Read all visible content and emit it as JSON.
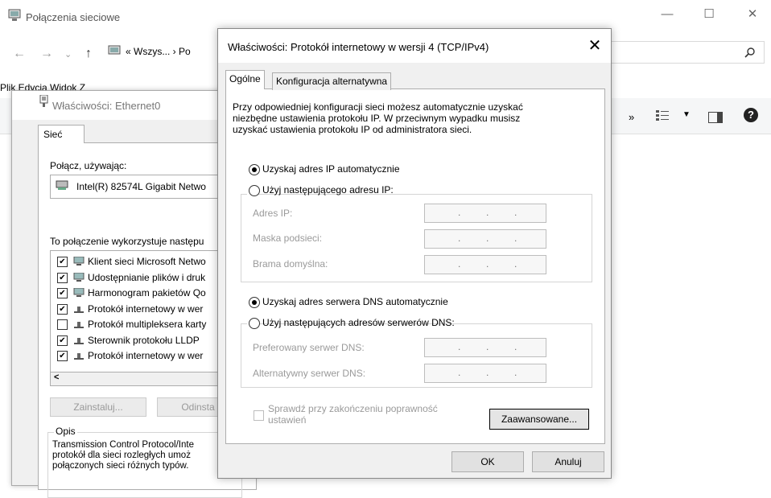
{
  "bg": {
    "title": "Połączenia sieciowe",
    "address": "« Wszys... › Po",
    "menu": "Plik   Edycja   Widok   Z",
    "toolbar_chevron": "»",
    "controls": {
      "minimize": "—",
      "maximize": "☐",
      "close": "✕"
    }
  },
  "eth": {
    "title": "Właściwości: Ethernet0",
    "tab": "Sieć",
    "connect_using_label": "Połącz, używając:",
    "adapter": "Intel(R) 82574L Gigabit Netwo",
    "uses_label": "To połączenie wykorzystuje następu",
    "items": [
      {
        "checked": true,
        "label": "Klient sieci Microsoft Netwo"
      },
      {
        "checked": true,
        "label": "Udostępnianie plików i druk"
      },
      {
        "checked": true,
        "label": "Harmonogram pakietów Qo"
      },
      {
        "checked": true,
        "label": "Protokół internetowy w wer"
      },
      {
        "checked": false,
        "label": "Protokół multipleksera karty"
      },
      {
        "checked": true,
        "label": "Sterownik protokołu LLDP"
      },
      {
        "checked": true,
        "label": "Protokół internetowy w wer"
      }
    ],
    "scroll_left": "<",
    "install_btn": "Zainstaluj...",
    "uninstall_btn": "Odinsta",
    "desc_legend": "Opis",
    "desc_lines": [
      "Transmission Control Protocol/Inte",
      "protokół dla sieci rozległych umoż",
      "połączonych sieci różnych typów."
    ]
  },
  "ipv4": {
    "title": "Właściwości: Protokół internetowy w wersji 4 (TCP/IPv4)",
    "close": "✕",
    "tabs": [
      "Ogólne",
      "Konfiguracja alternatywna"
    ],
    "intro_lines": [
      "Przy odpowiedniej konfiguracji sieci możesz automatycznie uzyskać",
      "niezbędne ustawienia protokołu IP. W przeciwnym wypadku musisz",
      "uzyskać ustawienia protokołu IP od administratora sieci."
    ],
    "radio_auto_ip": "Uzyskaj adres IP automatycznie",
    "radio_manual_ip": "Użyj następującego adresu IP:",
    "ip_label": "Adres IP:",
    "mask_label": "Maska podsieci:",
    "gateway_label": "Brama domyślna:",
    "radio_auto_dns": "Uzyskaj adres serwera DNS automatycznie",
    "radio_manual_dns": "Użyj następujących adresów serwerów DNS:",
    "pref_dns_label": "Preferowany serwer DNS:",
    "alt_dns_label": "Alternatywny serwer DNS:",
    "validate_line1": "Sprawdź przy zakończeniu poprawność",
    "validate_line2": "ustawień",
    "advanced_btn": "Zaawansowane...",
    "ok_btn": "OK",
    "cancel_btn": "Anuluj",
    "selected": {
      "ip_mode": "auto",
      "dns_mode": "auto",
      "validate": false
    }
  }
}
